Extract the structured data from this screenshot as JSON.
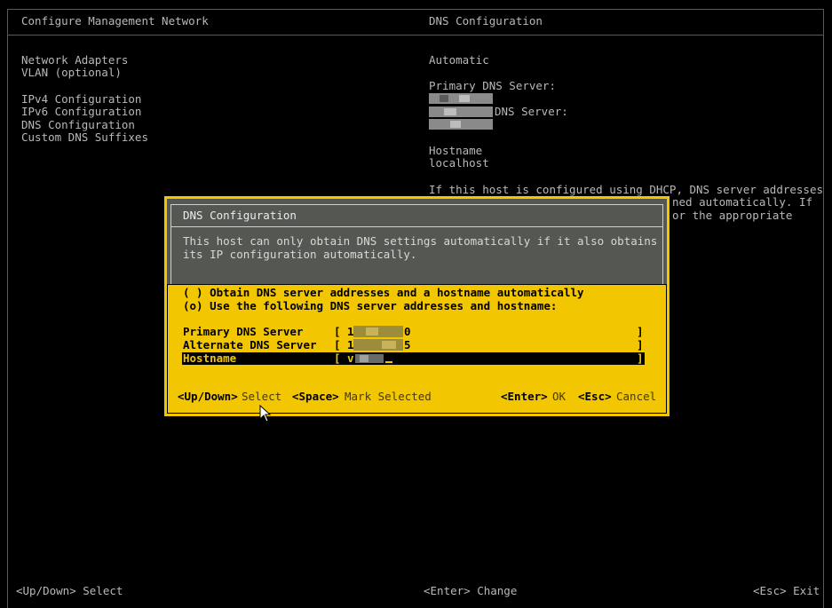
{
  "header": {
    "left_title": "Configure Management Network",
    "right_title": "DNS Configuration"
  },
  "menu": {
    "items": [
      "Network Adapters",
      "VLAN (optional)",
      "IPv4 Configuration",
      "IPv6 Configuration",
      "DNS Configuration",
      "Custom DNS Suffixes"
    ]
  },
  "info": {
    "mode": "Automatic",
    "primary_label": "Primary DNS Server:",
    "alternate_label": "DNS Server:",
    "hostname_label": "Hostname",
    "hostname_value": "localhost",
    "help_line1": "If this host is configured using DHCP, DNS server addresses",
    "help_line2": "ned automatically. If",
    "help_line3": "or the appropriate"
  },
  "dialog": {
    "title": "DNS Configuration",
    "desc_line1": "This host can only obtain DNS settings automatically if it also obtains",
    "desc_line2": "its IP configuration automatically.",
    "option_auto": "( ) Obtain DNS server addresses and a hostname automatically",
    "option_manual": "(o) Use the following DNS server addresses and hostname:",
    "primary_label": "Primary DNS Server",
    "primary_value": "[ 1",
    "primary_tail": "0",
    "alternate_label": "Alternate DNS Server",
    "alternate_value": "[ 1",
    "alternate_tail": "5",
    "hostname_label": "Hostname",
    "hostname_value": "[ v",
    "field_close": "]",
    "keys": {
      "updown": "<Up/Down>",
      "select": "Select",
      "space": "<Space>",
      "mark": "Mark Selected",
      "enter": "<Enter>",
      "ok": "OK",
      "esc": "<Esc>",
      "cancel": "Cancel"
    }
  },
  "footer": {
    "left": "<Up/Down> Select",
    "center": "<Enter> Change",
    "right": "<Esc> Exit"
  }
}
